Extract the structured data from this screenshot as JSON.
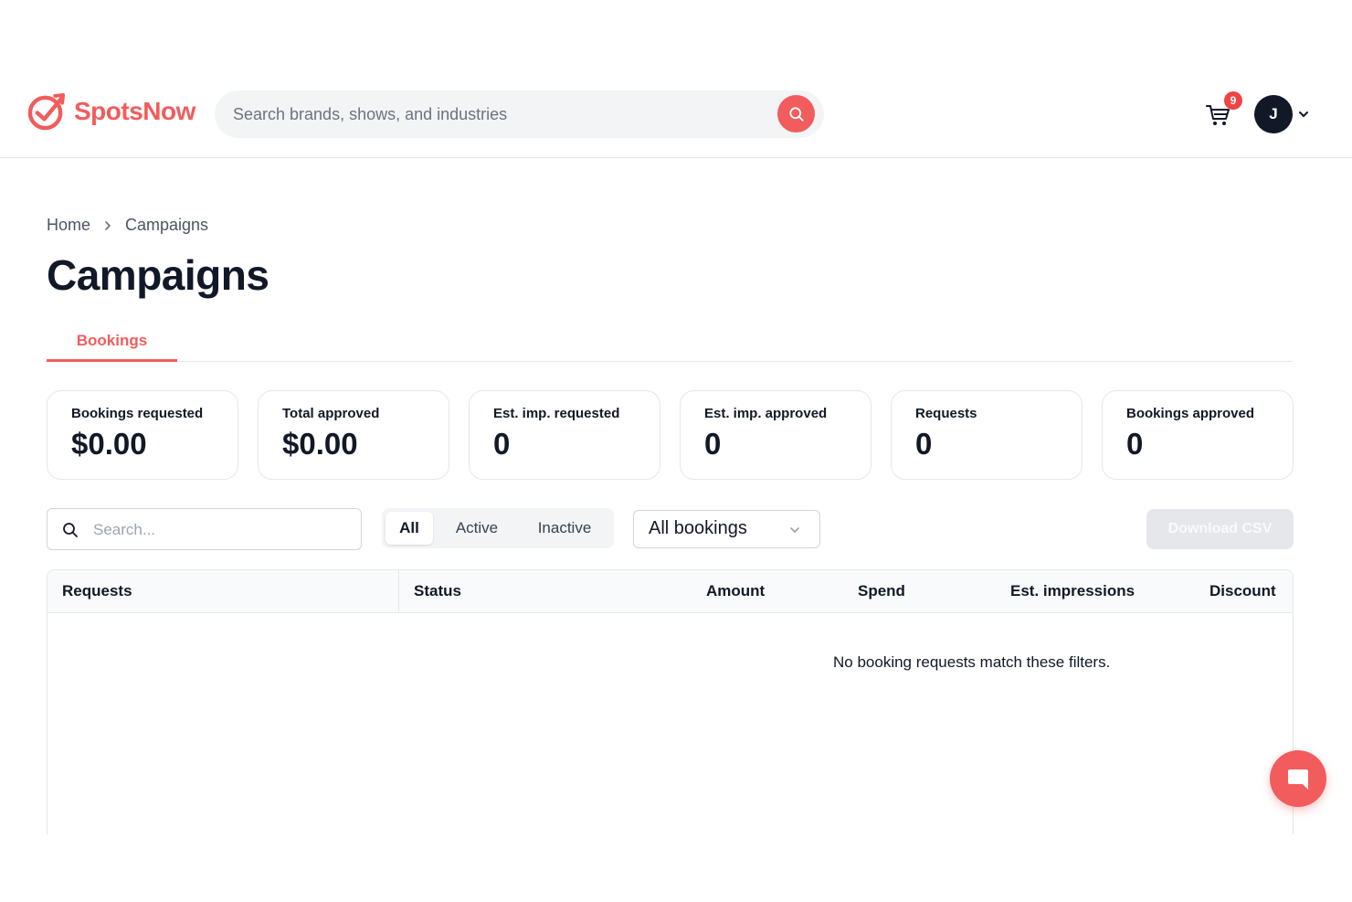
{
  "brand": {
    "name": "SpotsNow",
    "accent": "#f25c5c"
  },
  "header": {
    "search_placeholder": "Search brands, shows, and industries",
    "cart_count": "9",
    "avatar_initial": "J"
  },
  "breadcrumb": {
    "home": "Home",
    "current": "Campaigns"
  },
  "page": {
    "title": "Campaigns"
  },
  "tabs": [
    {
      "label": "Bookings",
      "active": true
    }
  ],
  "stats": [
    {
      "label": "Bookings requested",
      "value": "$0.00"
    },
    {
      "label": "Total approved",
      "value": "$0.00"
    },
    {
      "label": "Est. imp. requested",
      "value": "0"
    },
    {
      "label": "Est. imp. approved",
      "value": "0"
    },
    {
      "label": "Requests",
      "value": "0"
    },
    {
      "label": "Bookings approved",
      "value": "0"
    }
  ],
  "filters": {
    "search_placeholder": "Search...",
    "status_options": [
      "All",
      "Active",
      "Inactive"
    ],
    "status_selected": "All",
    "booking_select": "All bookings",
    "download_label": "Download CSV"
  },
  "table": {
    "columns": [
      "Requests",
      "Status",
      "Amount",
      "Spend",
      "Est. impressions",
      "Discount"
    ],
    "empty_message": "No booking requests match these filters."
  },
  "icons": {
    "logo": "target-check-icon",
    "search": "search-icon",
    "cart": "cart-icon",
    "chevron": "chevron-down-icon",
    "breadcrumb_sep": "chevron-right-icon",
    "chat": "chat-icon"
  }
}
